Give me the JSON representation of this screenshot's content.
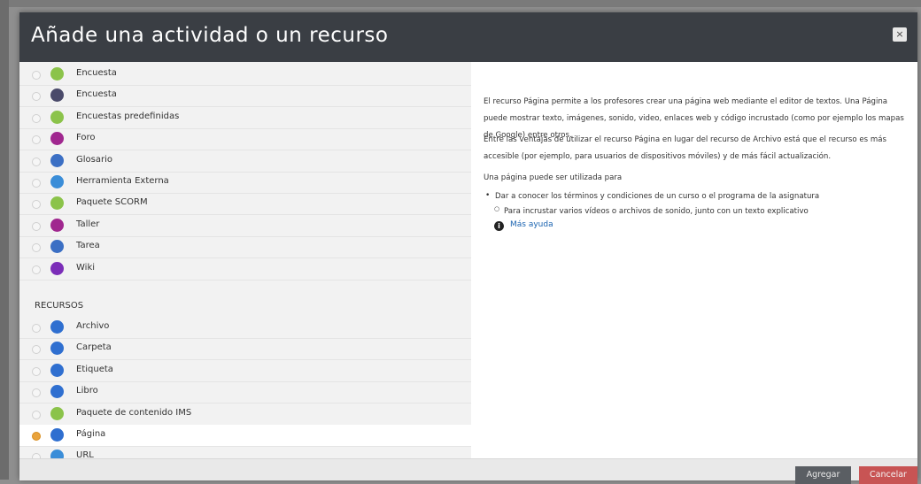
{
  "modal": {
    "title": "Añade una actividad o un recurso",
    "close_label": "×"
  },
  "activities": [
    {
      "label": "Encuesta",
      "icon": "survey-icon",
      "color": "#8bc34a"
    },
    {
      "label": "Encuesta",
      "icon": "feedback-icon",
      "color": "#4a4a6a"
    },
    {
      "label": "Encuestas predefinidas",
      "icon": "survey-chart-icon",
      "color": "#8bc34a"
    },
    {
      "label": "Foro",
      "icon": "forum-icon",
      "color": "#a0278f"
    },
    {
      "label": "Glosario",
      "icon": "glossary-icon",
      "color": "#3b6fc4"
    },
    {
      "label": "Herramienta Externa",
      "icon": "puzzle-icon",
      "color": "#3a8dd8"
    },
    {
      "label": "Paquete SCORM",
      "icon": "package-icon",
      "color": "#8bc34a"
    },
    {
      "label": "Taller",
      "icon": "workshop-icon",
      "color": "#a0278f"
    },
    {
      "label": "Tarea",
      "icon": "assignment-icon",
      "color": "#3b6fc4"
    },
    {
      "label": "Wiki",
      "icon": "wiki-icon",
      "color": "#7b2db8"
    }
  ],
  "resources_heading": "RECURSOS",
  "resources": [
    {
      "label": "Archivo",
      "icon": "file-icon",
      "color": "#2f6fd0",
      "selected": false
    },
    {
      "label": "Carpeta",
      "icon": "folder-icon",
      "color": "#2f6fd0",
      "selected": false
    },
    {
      "label": "Etiqueta",
      "icon": "label-icon",
      "color": "#2f6fd0",
      "selected": false
    },
    {
      "label": "Libro",
      "icon": "book-icon",
      "color": "#2f6fd0",
      "selected": false
    },
    {
      "label": "Paquete de contenido IMS",
      "icon": "ims-package-icon",
      "color": "#8bc34a",
      "selected": false
    },
    {
      "label": "Página",
      "icon": "page-icon",
      "color": "#2f6fd0",
      "selected": true
    },
    {
      "label": "URL",
      "icon": "link-icon",
      "color": "#3a8dd8",
      "selected": false
    }
  ],
  "description": {
    "p1": "El recurso Página permite a los profesores crear una página web mediante el editor de textos. Una Página puede mostrar texto, imágenes, sonido, video, enlaces web y código incrustado (como por ejemplo los mapas de Google) entre otros.",
    "p2": "Entre las ventajas de utilizar el recurso Página en lugar del recurso de Archivo está que el recurso es más accesible (por ejemplo, para usuarios de dispositivos móviles) y de más fácil actualización.",
    "p3": "Una página puede ser utilizada para",
    "bullet1": "Dar a conocer los términos y condiciones de un curso o el programa de la asignatura",
    "bullet2": "Para incrustar varios vídeos o archivos de sonido, junto con un texto explicativo",
    "help_link": "Más ayuda"
  },
  "footer": {
    "add_label": "Agregar",
    "cancel_label": "Cancelar"
  }
}
